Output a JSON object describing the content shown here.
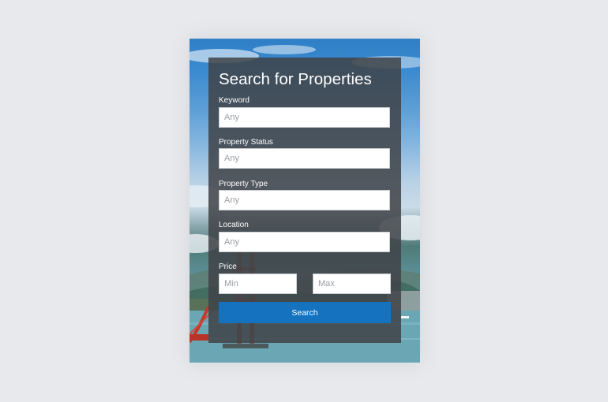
{
  "form": {
    "title": "Search for Properties",
    "fields": [
      {
        "label": "Keyword",
        "placeholder": "Any"
      },
      {
        "label": "Property Status",
        "placeholder": "Any"
      },
      {
        "label": "Property Type",
        "placeholder": "Any"
      },
      {
        "label": "Location",
        "placeholder": "Any"
      }
    ],
    "price": {
      "label": "Price",
      "min_placeholder": "Min",
      "max_placeholder": "Max"
    },
    "search_label": "Search"
  },
  "colors": {
    "page_background": "#e7e9ec",
    "panel_overlay": "#404448",
    "search_button": "#1472bf",
    "sky": "#3a8bd0",
    "bridge": "#c0392b"
  }
}
